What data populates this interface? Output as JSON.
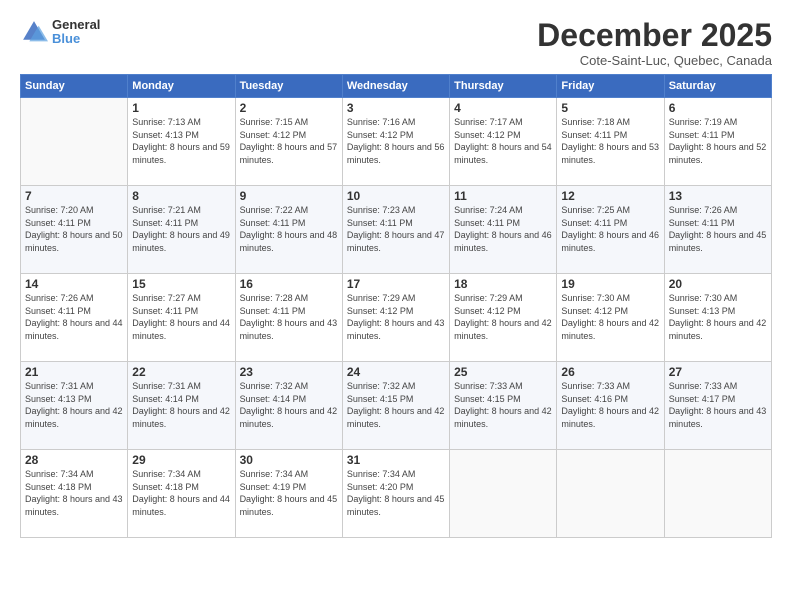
{
  "logo": {
    "line1": "General",
    "line2": "Blue"
  },
  "title": "December 2025",
  "subtitle": "Cote-Saint-Luc, Quebec, Canada",
  "headers": [
    "Sunday",
    "Monday",
    "Tuesday",
    "Wednesday",
    "Thursday",
    "Friday",
    "Saturday"
  ],
  "weeks": [
    [
      {
        "day": "",
        "sunrise": "",
        "sunset": "",
        "daylight": ""
      },
      {
        "day": "1",
        "sunrise": "Sunrise: 7:13 AM",
        "sunset": "Sunset: 4:13 PM",
        "daylight": "Daylight: 8 hours and 59 minutes."
      },
      {
        "day": "2",
        "sunrise": "Sunrise: 7:15 AM",
        "sunset": "Sunset: 4:12 PM",
        "daylight": "Daylight: 8 hours and 57 minutes."
      },
      {
        "day": "3",
        "sunrise": "Sunrise: 7:16 AM",
        "sunset": "Sunset: 4:12 PM",
        "daylight": "Daylight: 8 hours and 56 minutes."
      },
      {
        "day": "4",
        "sunrise": "Sunrise: 7:17 AM",
        "sunset": "Sunset: 4:12 PM",
        "daylight": "Daylight: 8 hours and 54 minutes."
      },
      {
        "day": "5",
        "sunrise": "Sunrise: 7:18 AM",
        "sunset": "Sunset: 4:11 PM",
        "daylight": "Daylight: 8 hours and 53 minutes."
      },
      {
        "day": "6",
        "sunrise": "Sunrise: 7:19 AM",
        "sunset": "Sunset: 4:11 PM",
        "daylight": "Daylight: 8 hours and 52 minutes."
      }
    ],
    [
      {
        "day": "7",
        "sunrise": "Sunrise: 7:20 AM",
        "sunset": "Sunset: 4:11 PM",
        "daylight": "Daylight: 8 hours and 50 minutes."
      },
      {
        "day": "8",
        "sunrise": "Sunrise: 7:21 AM",
        "sunset": "Sunset: 4:11 PM",
        "daylight": "Daylight: 8 hours and 49 minutes."
      },
      {
        "day": "9",
        "sunrise": "Sunrise: 7:22 AM",
        "sunset": "Sunset: 4:11 PM",
        "daylight": "Daylight: 8 hours and 48 minutes."
      },
      {
        "day": "10",
        "sunrise": "Sunrise: 7:23 AM",
        "sunset": "Sunset: 4:11 PM",
        "daylight": "Daylight: 8 hours and 47 minutes."
      },
      {
        "day": "11",
        "sunrise": "Sunrise: 7:24 AM",
        "sunset": "Sunset: 4:11 PM",
        "daylight": "Daylight: 8 hours and 46 minutes."
      },
      {
        "day": "12",
        "sunrise": "Sunrise: 7:25 AM",
        "sunset": "Sunset: 4:11 PM",
        "daylight": "Daylight: 8 hours and 46 minutes."
      },
      {
        "day": "13",
        "sunrise": "Sunrise: 7:26 AM",
        "sunset": "Sunset: 4:11 PM",
        "daylight": "Daylight: 8 hours and 45 minutes."
      }
    ],
    [
      {
        "day": "14",
        "sunrise": "Sunrise: 7:26 AM",
        "sunset": "Sunset: 4:11 PM",
        "daylight": "Daylight: 8 hours and 44 minutes."
      },
      {
        "day": "15",
        "sunrise": "Sunrise: 7:27 AM",
        "sunset": "Sunset: 4:11 PM",
        "daylight": "Daylight: 8 hours and 44 minutes."
      },
      {
        "day": "16",
        "sunrise": "Sunrise: 7:28 AM",
        "sunset": "Sunset: 4:11 PM",
        "daylight": "Daylight: 8 hours and 43 minutes."
      },
      {
        "day": "17",
        "sunrise": "Sunrise: 7:29 AM",
        "sunset": "Sunset: 4:12 PM",
        "daylight": "Daylight: 8 hours and 43 minutes."
      },
      {
        "day": "18",
        "sunrise": "Sunrise: 7:29 AM",
        "sunset": "Sunset: 4:12 PM",
        "daylight": "Daylight: 8 hours and 42 minutes."
      },
      {
        "day": "19",
        "sunrise": "Sunrise: 7:30 AM",
        "sunset": "Sunset: 4:12 PM",
        "daylight": "Daylight: 8 hours and 42 minutes."
      },
      {
        "day": "20",
        "sunrise": "Sunrise: 7:30 AM",
        "sunset": "Sunset: 4:13 PM",
        "daylight": "Daylight: 8 hours and 42 minutes."
      }
    ],
    [
      {
        "day": "21",
        "sunrise": "Sunrise: 7:31 AM",
        "sunset": "Sunset: 4:13 PM",
        "daylight": "Daylight: 8 hours and 42 minutes."
      },
      {
        "day": "22",
        "sunrise": "Sunrise: 7:31 AM",
        "sunset": "Sunset: 4:14 PM",
        "daylight": "Daylight: 8 hours and 42 minutes."
      },
      {
        "day": "23",
        "sunrise": "Sunrise: 7:32 AM",
        "sunset": "Sunset: 4:14 PM",
        "daylight": "Daylight: 8 hours and 42 minutes."
      },
      {
        "day": "24",
        "sunrise": "Sunrise: 7:32 AM",
        "sunset": "Sunset: 4:15 PM",
        "daylight": "Daylight: 8 hours and 42 minutes."
      },
      {
        "day": "25",
        "sunrise": "Sunrise: 7:33 AM",
        "sunset": "Sunset: 4:15 PM",
        "daylight": "Daylight: 8 hours and 42 minutes."
      },
      {
        "day": "26",
        "sunrise": "Sunrise: 7:33 AM",
        "sunset": "Sunset: 4:16 PM",
        "daylight": "Daylight: 8 hours and 42 minutes."
      },
      {
        "day": "27",
        "sunrise": "Sunrise: 7:33 AM",
        "sunset": "Sunset: 4:17 PM",
        "daylight": "Daylight: 8 hours and 43 minutes."
      }
    ],
    [
      {
        "day": "28",
        "sunrise": "Sunrise: 7:34 AM",
        "sunset": "Sunset: 4:18 PM",
        "daylight": "Daylight: 8 hours and 43 minutes."
      },
      {
        "day": "29",
        "sunrise": "Sunrise: 7:34 AM",
        "sunset": "Sunset: 4:18 PM",
        "daylight": "Daylight: 8 hours and 44 minutes."
      },
      {
        "day": "30",
        "sunrise": "Sunrise: 7:34 AM",
        "sunset": "Sunset: 4:19 PM",
        "daylight": "Daylight: 8 hours and 45 minutes."
      },
      {
        "day": "31",
        "sunrise": "Sunrise: 7:34 AM",
        "sunset": "Sunset: 4:20 PM",
        "daylight": "Daylight: 8 hours and 45 minutes."
      },
      {
        "day": "",
        "sunrise": "",
        "sunset": "",
        "daylight": ""
      },
      {
        "day": "",
        "sunrise": "",
        "sunset": "",
        "daylight": ""
      },
      {
        "day": "",
        "sunrise": "",
        "sunset": "",
        "daylight": ""
      }
    ]
  ]
}
